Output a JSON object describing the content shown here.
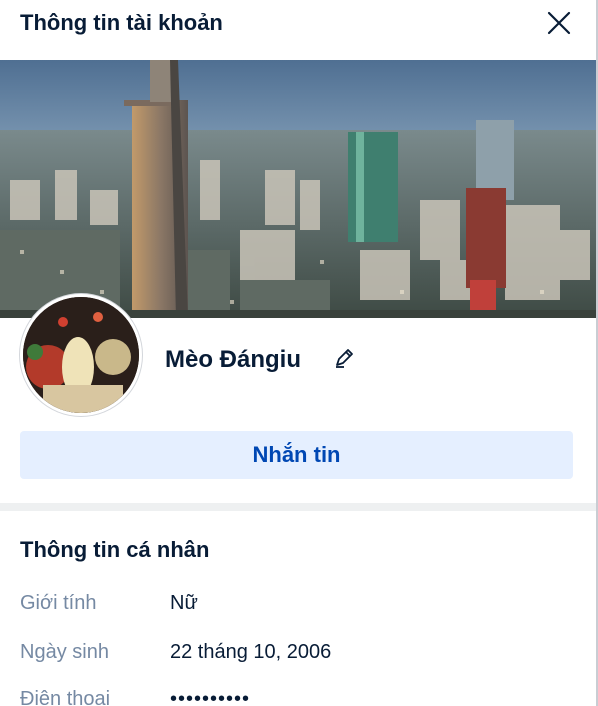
{
  "header": {
    "title": "Thông tin tài khoản"
  },
  "profile": {
    "name": "Mèo Đángiu"
  },
  "actions": {
    "message_label": "Nhắn tin"
  },
  "personal": {
    "title": "Thông tin cá nhân",
    "rows": [
      {
        "label": "Giới tính",
        "value": "Nữ"
      },
      {
        "label": "Ngày sinh",
        "value": "22 tháng 10, 2006"
      },
      {
        "label": "Điện thoại",
        "value": "••••••••••"
      }
    ]
  },
  "colors": {
    "primary_text": "#081c36",
    "muted_text": "#7589a3",
    "button_bg": "#e5efff",
    "button_text": "#0047b3",
    "divider": "#eef0f1"
  },
  "icons": {
    "close": "close-icon",
    "edit": "pencil-icon",
    "avatar": "avatar"
  }
}
